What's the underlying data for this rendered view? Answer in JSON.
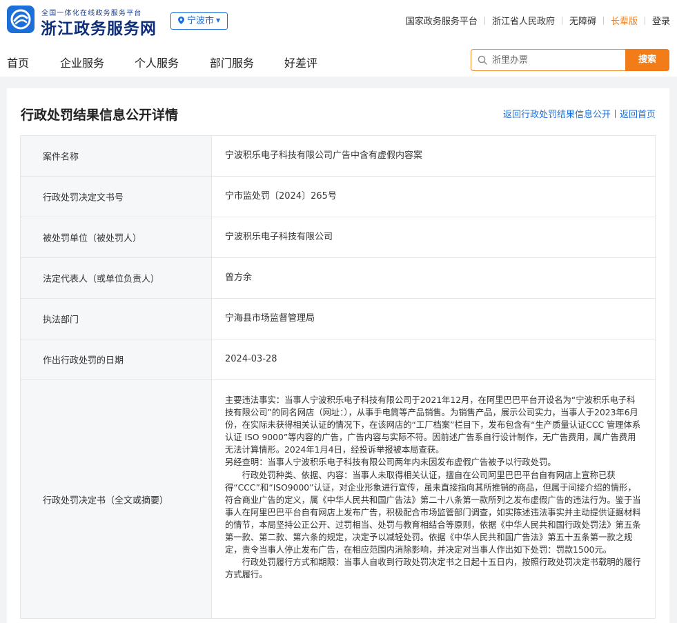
{
  "header": {
    "brand_subtitle": "全国一体化在线政务服务平台",
    "brand_title": "浙江政务服务网",
    "city": "宁波市",
    "top_links": [
      "国家政务服务平台",
      "浙江省人民政府",
      "无障碍",
      "长辈版",
      "登录"
    ]
  },
  "nav": {
    "items": [
      "首页",
      "企业服务",
      "个人服务",
      "部门服务",
      "好差评"
    ],
    "search_placeholder": "浙里办票",
    "search_button": "搜索"
  },
  "page": {
    "title": "行政处罚结果信息公开详情",
    "back_list": "返回行政处罚结果信息公开",
    "back_home": "返回首页"
  },
  "rows": [
    {
      "label": "案件名称",
      "value": "宁波积乐电子科技有限公司广告中含有虚假内容案"
    },
    {
      "label": "行政处罚决定文书号",
      "value": "宁市监处罚〔2024〕265号"
    },
    {
      "label": "被处罚单位（被处罚人）",
      "value": "宁波积乐电子科技有限公司"
    },
    {
      "label": "法定代表人（或单位负责人）",
      "value": "曾方余"
    },
    {
      "label": "执法部门",
      "value": "宁海县市场监督管理局"
    },
    {
      "label": "作出行政处罚的日期",
      "value": "2024-03-28"
    }
  ],
  "decision": {
    "label": "行政处罚决定书（全文或摘要）",
    "paragraphs": [
      "主要违法事实：当事人宁波积乐电子科技有限公司于2021年12月，在阿里巴巴平台开设名为“宁波积乐电子科技有限公司”的同名网店（网址：），从事手电筒等产品销售。为销售产品，展示公司实力，当事人于2023年6月份，在实际未获得相关认证的情况下，在该网店的“工厂档案”栏目下，发布包含有“生产质量认证CCC 管理体系认证 ISO 9000”等内容的广告，广告内容与实际不符。因前述广告系自行设计制作，无广告费用，属广告费用无法计算情形。2024年1月4日，经投诉举报被本局查获。",
      "另经查明：当事人宁波积乐电子科技有限公司两年内未因发布虚假广告被予以行政处罚。",
      "行政处罚种类、依据、内容：当事人未取得相关认证，擅自在公司阿里巴巴平台自有网店上宣称已获得“CCC”和“ISO9000”认证，对企业形象进行宣传，虽未直接指向其所推销的商品，但属于间接介绍的情形，符合商业广告的定义，属《中华人民共和国广告法》第二十八条第一款所列之发布虚假广告的违法行为。鉴于当事人在阿里巴巴平台自有网店上发布广告，积极配合市场监管部门调查，如实陈述违法事实并主动提供证据材料的情节，本局坚持公正公开、过罚相当、处罚与教育相结合等原则，依据《中华人民共和国行政处罚法》第五条第一款、第二款、第六条的规定，决定予以减轻处罚。依据《中华人民共和国广告法》第五十五条第一款之规定，责令当事人停止发布广告，在相应范围内消除影响，并决定对当事人作出如下处罚：罚款1500元。",
      "行政处罚履行方式和期限：当事人自收到行政处罚决定书之日起十五日内，按照行政处罚决定书载明的履行方式履行。"
    ]
  },
  "colors": {
    "brand_blue": "#1d6fd8",
    "accent_orange": "#f27c18"
  }
}
